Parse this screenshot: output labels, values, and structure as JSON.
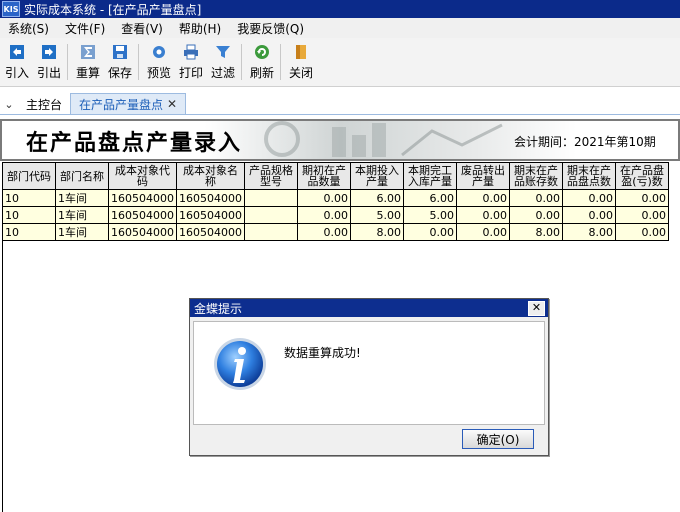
{
  "app": {
    "title": "实际成本系统 - [在产品产量盘点]",
    "logo_text": "KIS"
  },
  "menu": [
    "系统(S)",
    "文件(F)",
    "查看(V)",
    "帮助(H)",
    "我要反馈(Q)"
  ],
  "toolbar": {
    "import": "引入",
    "export": "引出",
    "recalc": "重算",
    "save": "保存",
    "preview": "预览",
    "print": "打印",
    "filter": "过滤",
    "refresh": "刷新",
    "close": "关闭"
  },
  "tabs": {
    "home": "主控台",
    "current": "在产品产量盘点",
    "close_glyph": "✕",
    "arrow": "⌄"
  },
  "banner": {
    "title": "在产品盘点产量录入",
    "period": "会计期间：2021年第10期"
  },
  "table": {
    "headers": [
      "部门代码",
      "部门名称",
      "成本对象代码",
      "成本对象名称",
      "产品规格型号",
      "期初在产品数量",
      "本期投入产量",
      "本期完工入库产量",
      "废品转出产量",
      "期末在产品账存数",
      "期末在产品盘点数",
      "在产品盘盈(亏)数"
    ],
    "rows": [
      [
        "10",
        "1车间",
        "160504000",
        "160504000",
        "",
        "0.00",
        "6.00",
        "6.00",
        "0.00",
        "0.00",
        "0.00",
        "0.00"
      ],
      [
        "10",
        "1车间",
        "160504000",
        "160504000",
        "",
        "0.00",
        "5.00",
        "5.00",
        "0.00",
        "0.00",
        "0.00",
        "0.00"
      ],
      [
        "10",
        "1车间",
        "160504000",
        "160504000",
        "",
        "0.00",
        "8.00",
        "0.00",
        "0.00",
        "8.00",
        "8.00",
        "0.00"
      ]
    ]
  },
  "dialog": {
    "title": "金蝶提示",
    "message": "数据重算成功!",
    "ok": "确定(O)",
    "close_glyph": "✕"
  },
  "colors": {
    "titlebar": "#0b2a8a",
    "cell_bg": "#ffffe0",
    "tab_active": "#1d5fb8"
  }
}
